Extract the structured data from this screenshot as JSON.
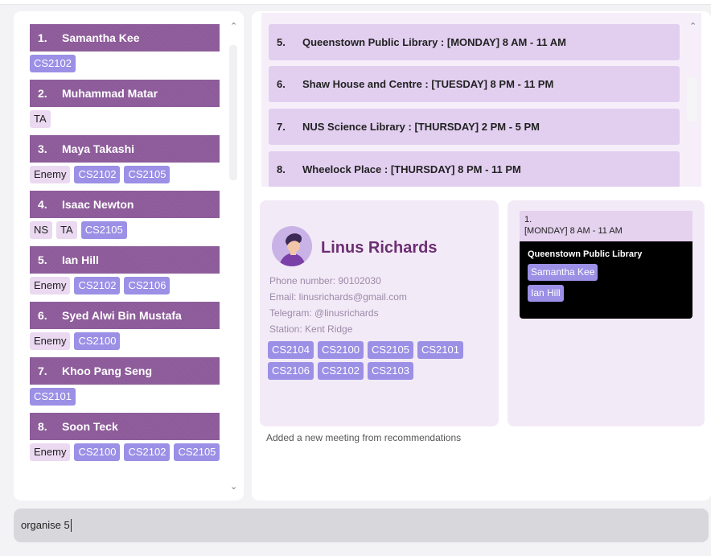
{
  "contacts": [
    {
      "index": "1.",
      "name": "Samantha Kee",
      "tags": [
        {
          "text": "CS2102",
          "kind": "course"
        }
      ]
    },
    {
      "index": "2.",
      "name": "Muhammad Matar",
      "tags": [
        {
          "text": "TA",
          "kind": "role"
        }
      ]
    },
    {
      "index": "3.",
      "name": "Maya Takashi",
      "tags": [
        {
          "text": "Enemy",
          "kind": "role"
        },
        {
          "text": "CS2102",
          "kind": "course"
        },
        {
          "text": "CS2105",
          "kind": "course"
        }
      ]
    },
    {
      "index": "4.",
      "name": "Isaac Newton",
      "tags": [
        {
          "text": "NS",
          "kind": "role"
        },
        {
          "text": "TA",
          "kind": "role"
        },
        {
          "text": "CS2105",
          "kind": "course"
        }
      ]
    },
    {
      "index": "5.",
      "name": "Ian Hill",
      "tags": [
        {
          "text": "Enemy",
          "kind": "role"
        },
        {
          "text": "CS2102",
          "kind": "course"
        },
        {
          "text": "CS2106",
          "kind": "course"
        }
      ]
    },
    {
      "index": "6.",
      "name": "Syed Alwi Bin Mustafa",
      "tags": [
        {
          "text": "Enemy",
          "kind": "role"
        },
        {
          "text": "CS2100",
          "kind": "course"
        }
      ]
    },
    {
      "index": "7.",
      "name": "Khoo Pang Seng",
      "tags": [
        {
          "text": "CS2101",
          "kind": "course"
        }
      ]
    },
    {
      "index": "8.",
      "name": "Soon Teck",
      "tags": [
        {
          "text": "Enemy",
          "kind": "role"
        },
        {
          "text": "CS2100",
          "kind": "course"
        },
        {
          "text": "CS2102",
          "kind": "course"
        },
        {
          "text": "CS2105",
          "kind": "course"
        }
      ]
    }
  ],
  "meetings": [
    {
      "index": "5.",
      "text": "Queenstown Public Library : [MONDAY] 8 AM - 11 AM"
    },
    {
      "index": "6.",
      "text": "Shaw House and Centre : [TUESDAY] 8 PM - 11 PM"
    },
    {
      "index": "7.",
      "text": "NUS Science Library : [THURSDAY] 2 PM - 5 PM"
    },
    {
      "index": "8.",
      "text": "Wheelock Place : [THURSDAY] 8 PM - 11 PM"
    }
  ],
  "person": {
    "name": "Linus Richards",
    "phone": "Phone number: 90102030",
    "email": "Email: linusrichards@gmail.com",
    "telegram": "Telegram: @linusrichards",
    "station": "Station: Kent Ridge",
    "tags": [
      "CS2104",
      "CS2100",
      "CS2105",
      "CS2101",
      "CS2106",
      "CS2102",
      "CS2103"
    ]
  },
  "schedule": {
    "index": "1.",
    "time": "[MONDAY] 8 AM - 11 AM",
    "place": "Queenstown Public Library",
    "people": [
      "Samantha Kee",
      "Ian Hill"
    ]
  },
  "result_message": "Added a new meeting from recommendations",
  "command": {
    "value": "organise 5"
  },
  "colors": {
    "header": "#8c5a99",
    "course_tag": "#9b8fe6",
    "role_tag": "#ead9f0",
    "name_accent": "#6b2f73"
  },
  "icons": {
    "scroll_up": "chevron-up-icon",
    "scroll_down": "chevron-down-icon",
    "avatar": "avatar-icon"
  }
}
